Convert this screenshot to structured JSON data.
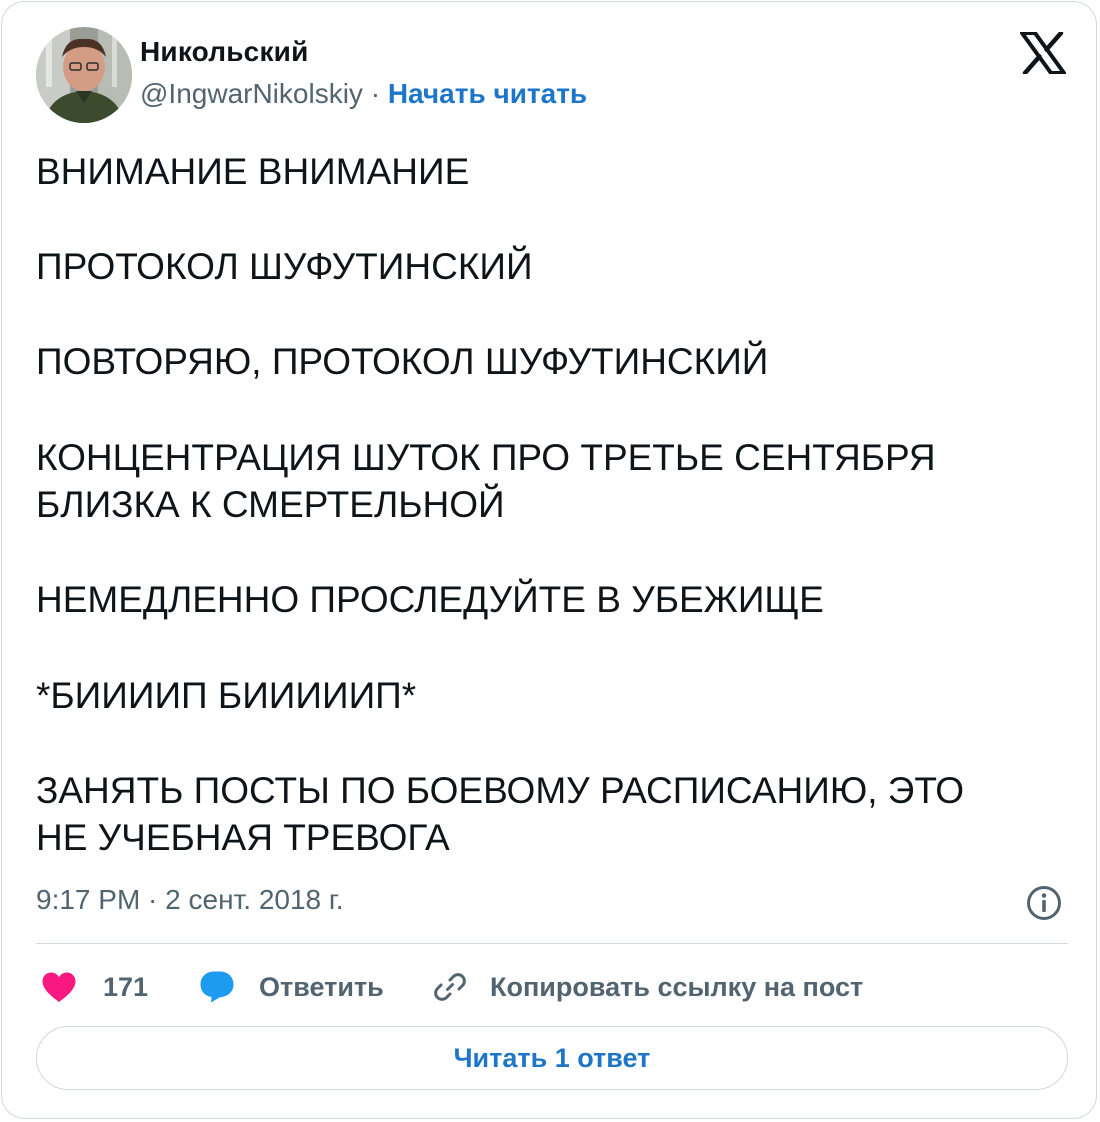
{
  "author": {
    "name": "Никольский",
    "handle": "@IngwarNikolskiy",
    "separator": " · ",
    "follow_label": "Начать читать"
  },
  "tweet": {
    "text": "ВНИМАНИЕ ВНИМАНИЕ\n\nПРОТОКОЛ ШУФУТИНСКИЙ\n\nПОВТОРЯЮ, ПРОТОКОЛ ШУФУТИНСКИЙ\n\nКОНЦЕНТРАЦИЯ ШУТОК ПРО ТРЕТЬЕ СЕНТЯБРЯ\nБЛИЗКА К СМЕРТЕЛЬНОЙ\n\nНЕМЕДЛЕННО ПРОСЛЕДУЙТЕ В УБЕЖИЩЕ\n\n*БИИИИП БИИИИИП*\n\nЗАНЯТЬ ПОСТЫ ПО БОЕВОМУ РАСПИСАНИЮ, ЭТО\nНЕ УЧЕБНАЯ ТРЕВОГА",
    "timestamp": "9:17 PM · 2 сент. 2018 г."
  },
  "actions": {
    "like_count": "171",
    "reply_label": "Ответить",
    "copy_link_label": "Копировать ссылку на пост"
  },
  "footer": {
    "read_replies_label": "Читать 1 ответ"
  },
  "icons": {
    "brand": "x-logo-icon",
    "info": "info-icon",
    "like": "heart-icon",
    "reply": "speech-bubble-icon",
    "copy": "link-icon"
  },
  "colors": {
    "text": "#0f1419",
    "secondary": "#536471",
    "link": "#1d76c8",
    "like": "#f91880",
    "reply": "#1d9bf0",
    "border": "#cfd9de"
  }
}
